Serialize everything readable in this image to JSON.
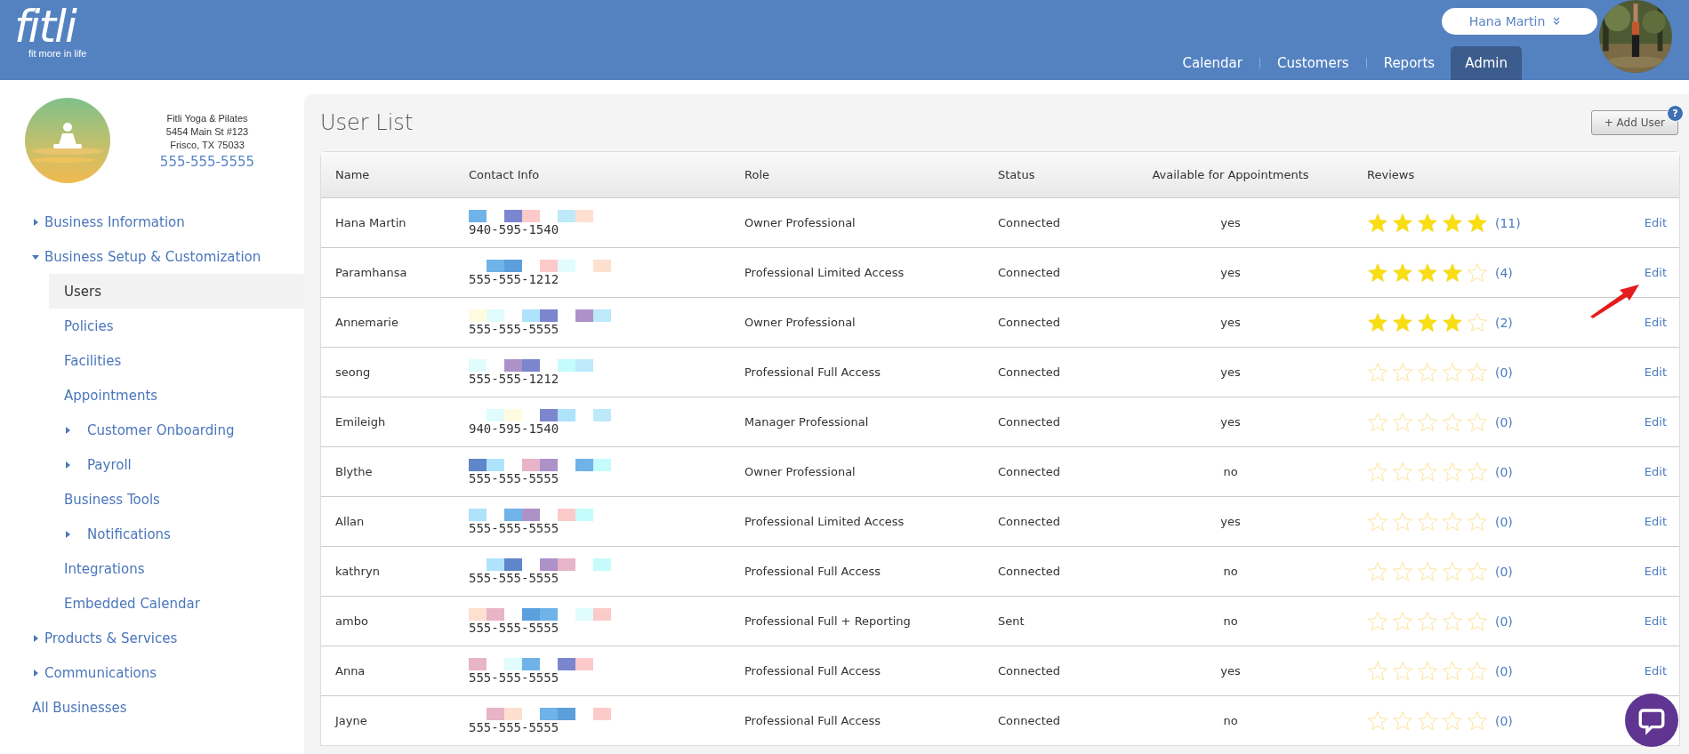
{
  "header": {
    "logo": "fitli",
    "tagline": "fit more in life",
    "user_menu": "Hana Martin",
    "nav": [
      {
        "label": "Calendar",
        "selected": false
      },
      {
        "label": "Customers",
        "selected": false
      },
      {
        "label": "Reports",
        "selected": false
      },
      {
        "label": "Admin",
        "selected": true
      }
    ]
  },
  "business": {
    "name": "Fitli Yoga & Pilates",
    "address_line_1": "5454 Main St #123",
    "address_line_2": "Frisco, TX 75033",
    "phone": "555-555-5555"
  },
  "sidebar": {
    "items": [
      {
        "label": "Business Information",
        "expanded": false,
        "selected": false
      },
      {
        "label": "Business Setup & Customization",
        "expanded": true,
        "selected": false,
        "children": [
          {
            "label": "Users",
            "selected": true
          },
          {
            "label": "Policies",
            "selected": false
          },
          {
            "label": "Facilities",
            "selected": false
          },
          {
            "label": "Appointments",
            "selected": false
          },
          {
            "label": "Customer Onboarding",
            "expanded": false,
            "selected": false
          },
          {
            "label": "Payroll",
            "expanded": false,
            "selected": false
          },
          {
            "label": "Business Tools",
            "selected": false
          },
          {
            "label": "Notifications",
            "expanded": false,
            "selected": false
          },
          {
            "label": "Integrations",
            "selected": false
          },
          {
            "label": "Embedded Calendar",
            "selected": false
          }
        ]
      },
      {
        "label": "Products & Services",
        "expanded": false,
        "selected": false
      },
      {
        "label": "Communications",
        "expanded": false,
        "selected": false
      },
      {
        "label": "All Businesses",
        "selected": false
      }
    ]
  },
  "main": {
    "title": "User List",
    "add_button": "+ Add User",
    "help": "?"
  },
  "table": {
    "columns": [
      "Name",
      "Contact Info",
      "Role",
      "Status",
      "Available for Appointments",
      "Reviews"
    ],
    "rows": [
      {
        "name": "Hana Martin",
        "phone": "940-595-1540",
        "role": "Owner Professional",
        "status": "Connected",
        "available": "yes",
        "stars": 5,
        "count": "(11)",
        "edit": "Edit"
      },
      {
        "name": "Paramhansa",
        "phone": "555-555-1212",
        "role": "Professional Limited Access",
        "status": "Connected",
        "available": "yes",
        "stars": 4,
        "count": "(4)",
        "edit": "Edit"
      },
      {
        "name": "Annemarie",
        "phone": "555-555-5555",
        "role": "Owner Professional",
        "status": "Connected",
        "available": "yes",
        "stars": 4,
        "count": "(2)",
        "edit": "Edit"
      },
      {
        "name": "seong",
        "phone": "555-555-1212",
        "role": "Professional Full Access",
        "status": "Connected",
        "available": "yes",
        "stars": 0,
        "count": "(0)",
        "edit": "Edit"
      },
      {
        "name": "Emileigh",
        "phone": "940-595-1540",
        "role": "Manager Professional",
        "status": "Connected",
        "available": "yes",
        "stars": 0,
        "count": "(0)",
        "edit": "Edit"
      },
      {
        "name": "Blythe",
        "phone": "555-555-5555",
        "role": "Owner Professional",
        "status": "Connected",
        "available": "no",
        "stars": 0,
        "count": "(0)",
        "edit": "Edit"
      },
      {
        "name": "Allan",
        "phone": "555-555-5555",
        "role": "Professional Limited Access",
        "status": "Connected",
        "available": "yes",
        "stars": 0,
        "count": "(0)",
        "edit": "Edit"
      },
      {
        "name": "kathryn",
        "phone": "555-555-5555",
        "role": "Professional Full Access",
        "status": "Connected",
        "available": "no",
        "stars": 0,
        "count": "(0)",
        "edit": "Edit"
      },
      {
        "name": "ambo",
        "phone": "555-555-5555",
        "role": "Professional Full + Reporting",
        "status": "Sent",
        "available": "no",
        "stars": 0,
        "count": "(0)",
        "edit": "Edit"
      },
      {
        "name": "Anna",
        "phone": "555-555-5555",
        "role": "Professional Full Access",
        "status": "Connected",
        "available": "yes",
        "stars": 0,
        "count": "(0)",
        "edit": "Edit"
      },
      {
        "name": "Jayne",
        "phone": "555-555-5555",
        "role": "Professional Full Access",
        "status": "Connected",
        "available": "no",
        "stars": 0,
        "count": "(0)"
      }
    ]
  }
}
